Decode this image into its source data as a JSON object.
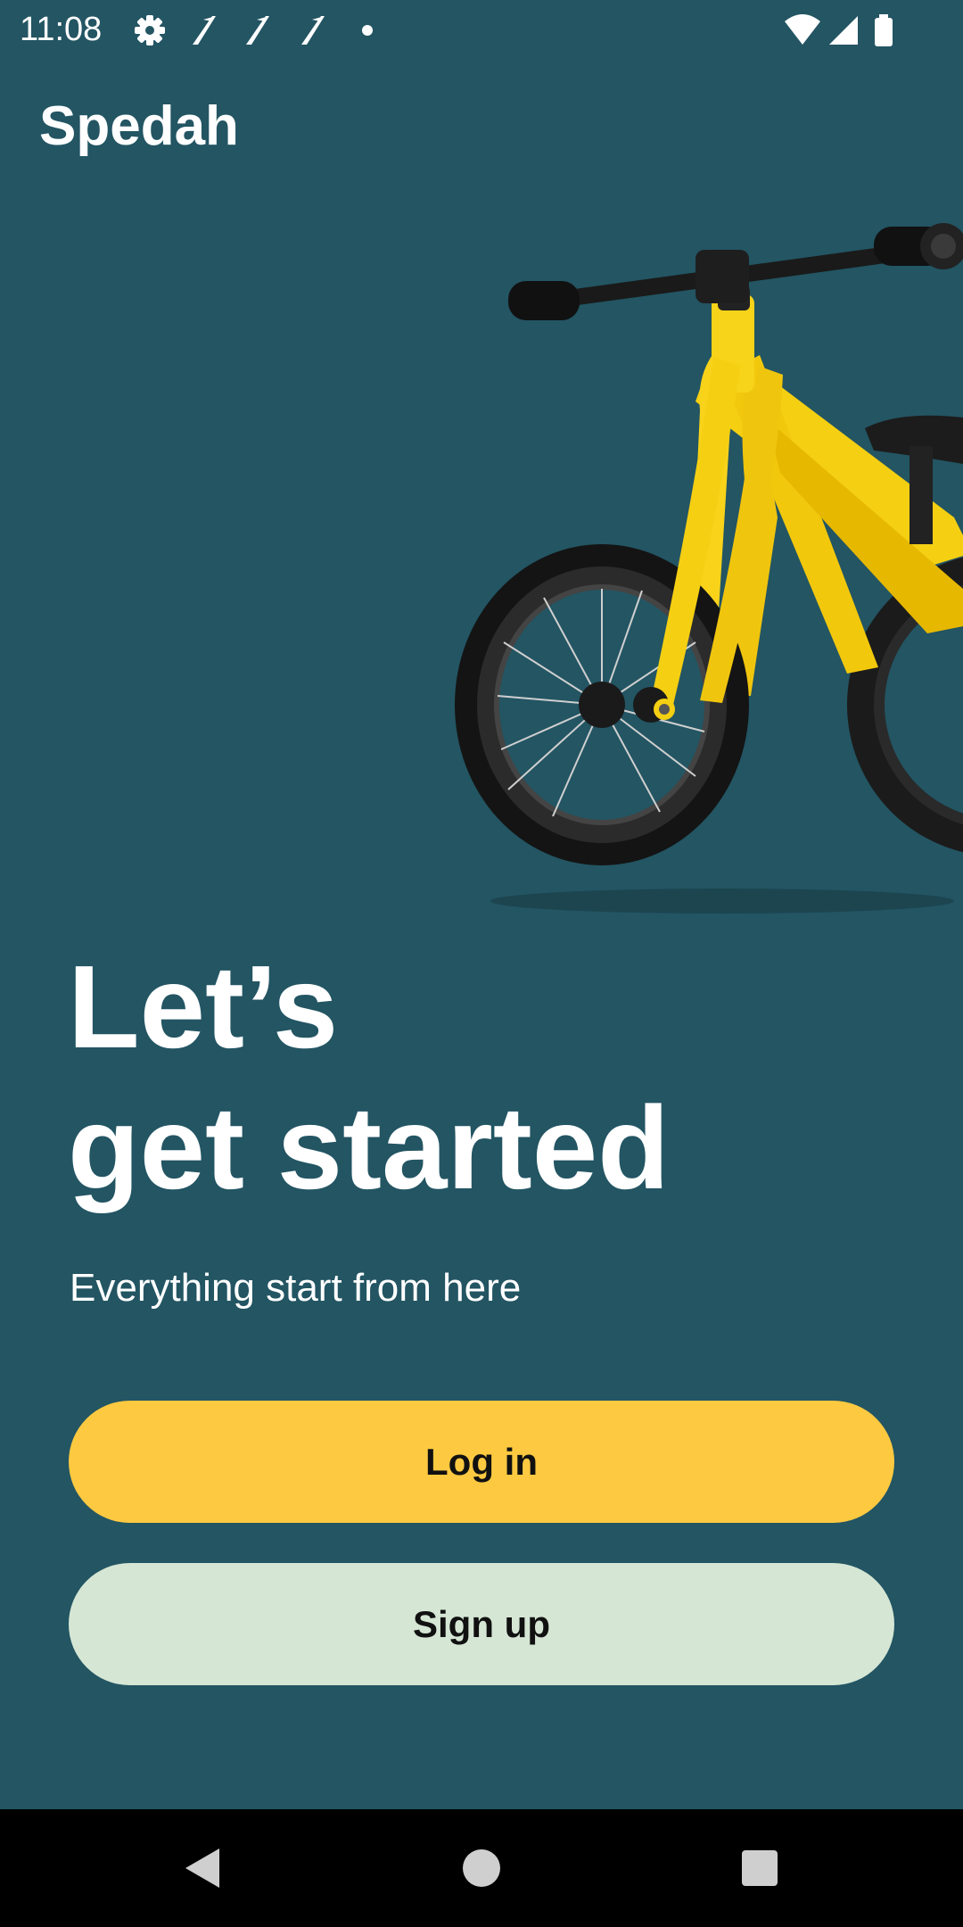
{
  "status_bar": {
    "time": "11:08",
    "icons": [
      "gear-icon",
      "app-notification-icon",
      "app-notification-icon",
      "app-notification-icon",
      "dot-icon",
      "wifi-icon",
      "cell-signal-icon",
      "battery-icon"
    ]
  },
  "app": {
    "title": "Spedah"
  },
  "hero": {
    "image": "yellow-balance-bike",
    "headline_line1": "Let’s",
    "headline_line2": "get started",
    "subtitle": "Everything start from here"
  },
  "actions": {
    "login_label": "Log in",
    "signup_label": "Sign up"
  },
  "nav_bar": {
    "icons": [
      "back-icon",
      "home-icon",
      "recents-icon"
    ]
  },
  "colors": {
    "background": "#235563",
    "login_button": "#fcc941",
    "signup_button": "#d5e6d4",
    "text": "#ffffff"
  }
}
